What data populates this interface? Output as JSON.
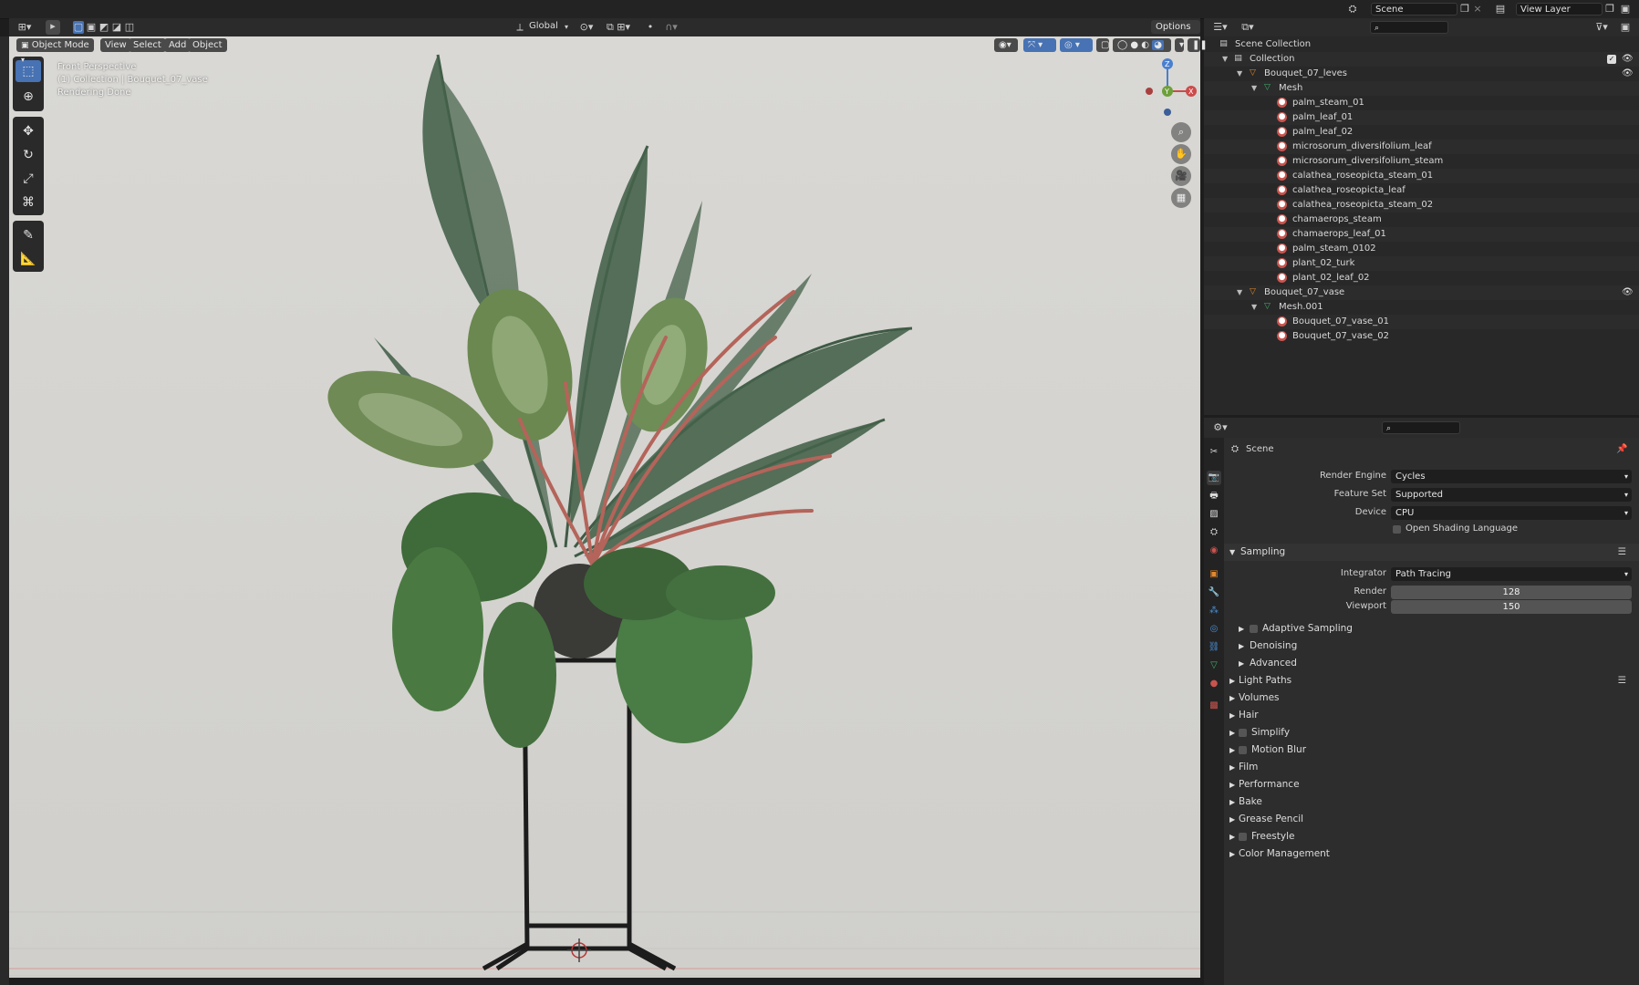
{
  "topbar": {
    "scene_label": "Scene",
    "view_layer_label": "View Layer"
  },
  "viewport_header": {
    "mode": "Object Mode",
    "menus": [
      "View",
      "Select",
      "Add",
      "Object"
    ],
    "orientation": "Global",
    "options": "Options"
  },
  "viewport": {
    "overlay_lines": [
      "Front Perspective",
      "(1) Collection | Bouquet_07_vase",
      "Rendering Done"
    ],
    "gizmo": {
      "z": "Z",
      "y": "Y",
      "x": "X"
    }
  },
  "outliner": {
    "root": "Scene Collection",
    "collection": "Collection",
    "objects": [
      {
        "name": "Bouquet_07_leves",
        "mesh": "Mesh",
        "materials": [
          "palm_steam_01",
          "palm_leaf_01",
          "palm_leaf_02",
          "microsorum_diversifolium_leaf",
          "microsorum_diversifolium_steam",
          "calathea_roseopicta_steam_01",
          "calathea_roseopicta_leaf",
          "calathea_roseopicta_steam_02",
          "chamaerops_steam",
          "chamaerops_leaf_01",
          "palm_steam_0102",
          "plant_02_turk",
          "plant_02_leaf_02"
        ]
      },
      {
        "name": "Bouquet_07_vase",
        "mesh": "Mesh.001",
        "materials": [
          "Bouquet_07_vase_01",
          "Bouquet_07_vase_02"
        ]
      }
    ]
  },
  "properties": {
    "context": "Scene",
    "render_engine_label": "Render Engine",
    "render_engine": "Cycles",
    "feature_set_label": "Feature Set",
    "feature_set": "Supported",
    "device_label": "Device",
    "device": "CPU",
    "osl_label": "Open Shading Language",
    "sampling": {
      "title": "Sampling",
      "integrator_label": "Integrator",
      "integrator": "Path Tracing",
      "render_label": "Render",
      "render": "128",
      "viewport_label": "Viewport",
      "viewport": "150",
      "subpanels": [
        "Adaptive Sampling",
        "Denoising",
        "Advanced"
      ]
    },
    "sections": [
      "Light Paths",
      "Volumes",
      "Hair",
      "Simplify",
      "Motion Blur",
      "Film",
      "Performance",
      "Bake",
      "Grease Pencil",
      "Freestyle",
      "Color Management"
    ]
  },
  "colors": {
    "accent": "#4772b3",
    "mesh_icon": "#3fb06b",
    "object_icon": "#e0892f",
    "material_icon": "#c9544e"
  }
}
